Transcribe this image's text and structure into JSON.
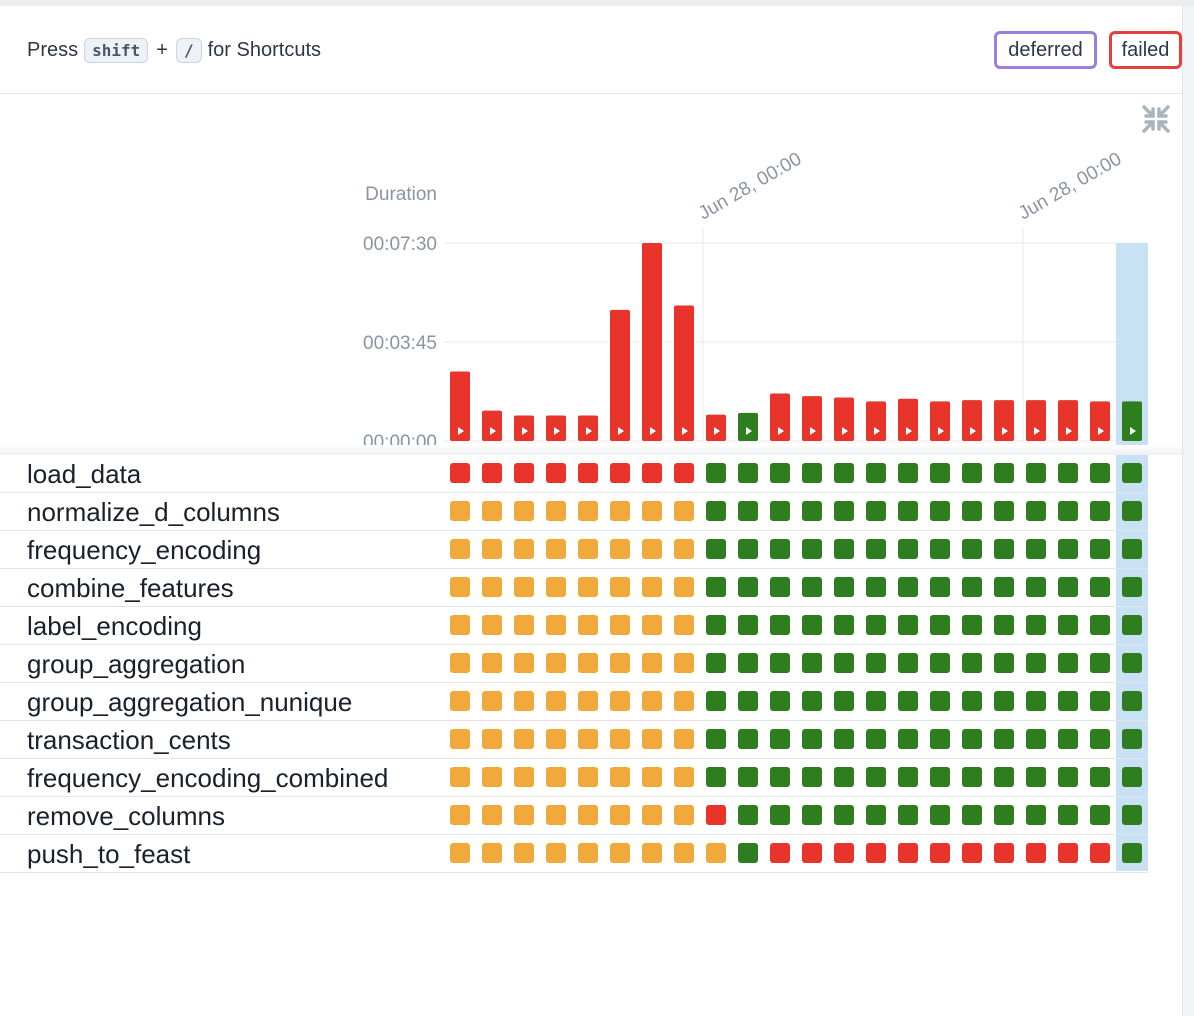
{
  "header": {
    "press_label": "Press",
    "key_shift": "shift",
    "plus": "+",
    "key_slash": "/",
    "shortcuts_label": "for Shortcuts",
    "badge_deferred": "deferred",
    "badge_failed": "failed"
  },
  "colors": {
    "success": "#2e7d1f",
    "failed": "#e8342a",
    "upstream_failed": "#f2a93b",
    "selected_column": "#c8e1f5",
    "deferred_border": "#9b7fe0",
    "failed_border": "#e53e3e"
  },
  "icons": {
    "collapse": "collapse-arrows-icon",
    "play": "play-triangle-icon"
  },
  "chart_data": {
    "type": "bar",
    "title": "",
    "ylabel": "Duration",
    "xlabel": "",
    "yticks": [
      "00:00:00",
      "00:03:45",
      "00:07:30"
    ],
    "ylim_seconds": [
      0,
      450
    ],
    "x_annotations": [
      {
        "label": "Jun 28, 00:00",
        "run_index": 8
      },
      {
        "label": "Jun 28, 00:00",
        "run_index": 18
      }
    ],
    "durations_seconds": [
      158,
      69,
      58,
      58,
      58,
      298,
      450,
      308,
      60,
      64,
      108,
      102,
      99,
      90,
      96,
      90,
      93,
      93,
      93,
      93,
      90,
      90
    ],
    "run_states": [
      "failed",
      "failed",
      "failed",
      "failed",
      "failed",
      "failed",
      "failed",
      "failed",
      "failed",
      "success",
      "failed",
      "failed",
      "failed",
      "failed",
      "failed",
      "failed",
      "failed",
      "failed",
      "failed",
      "failed",
      "failed",
      "success"
    ],
    "selected_run_index": 21
  },
  "tasks": [
    {
      "name": "load_data",
      "states": [
        "failed",
        "failed",
        "failed",
        "failed",
        "failed",
        "failed",
        "failed",
        "failed",
        "success",
        "success",
        "success",
        "success",
        "success",
        "success",
        "success",
        "success",
        "success",
        "success",
        "success",
        "success",
        "success",
        "success"
      ]
    },
    {
      "name": "normalize_d_columns",
      "states": [
        "upstream_failed",
        "upstream_failed",
        "upstream_failed",
        "upstream_failed",
        "upstream_failed",
        "upstream_failed",
        "upstream_failed",
        "upstream_failed",
        "success",
        "success",
        "success",
        "success",
        "success",
        "success",
        "success",
        "success",
        "success",
        "success",
        "success",
        "success",
        "success",
        "success"
      ]
    },
    {
      "name": "frequency_encoding",
      "states": [
        "upstream_failed",
        "upstream_failed",
        "upstream_failed",
        "upstream_failed",
        "upstream_failed",
        "upstream_failed",
        "upstream_failed",
        "upstream_failed",
        "success",
        "success",
        "success",
        "success",
        "success",
        "success",
        "success",
        "success",
        "success",
        "success",
        "success",
        "success",
        "success",
        "success"
      ]
    },
    {
      "name": "combine_features",
      "states": [
        "upstream_failed",
        "upstream_failed",
        "upstream_failed",
        "upstream_failed",
        "upstream_failed",
        "upstream_failed",
        "upstream_failed",
        "upstream_failed",
        "success",
        "success",
        "success",
        "success",
        "success",
        "success",
        "success",
        "success",
        "success",
        "success",
        "success",
        "success",
        "success",
        "success"
      ]
    },
    {
      "name": "label_encoding",
      "states": [
        "upstream_failed",
        "upstream_failed",
        "upstream_failed",
        "upstream_failed",
        "upstream_failed",
        "upstream_failed",
        "upstream_failed",
        "upstream_failed",
        "success",
        "success",
        "success",
        "success",
        "success",
        "success",
        "success",
        "success",
        "success",
        "success",
        "success",
        "success",
        "success",
        "success"
      ]
    },
    {
      "name": "group_aggregation",
      "states": [
        "upstream_failed",
        "upstream_failed",
        "upstream_failed",
        "upstream_failed",
        "upstream_failed",
        "upstream_failed",
        "upstream_failed",
        "upstream_failed",
        "success",
        "success",
        "success",
        "success",
        "success",
        "success",
        "success",
        "success",
        "success",
        "success",
        "success",
        "success",
        "success",
        "success"
      ]
    },
    {
      "name": "group_aggregation_nunique",
      "states": [
        "upstream_failed",
        "upstream_failed",
        "upstream_failed",
        "upstream_failed",
        "upstream_failed",
        "upstream_failed",
        "upstream_failed",
        "upstream_failed",
        "success",
        "success",
        "success",
        "success",
        "success",
        "success",
        "success",
        "success",
        "success",
        "success",
        "success",
        "success",
        "success",
        "success"
      ]
    },
    {
      "name": "transaction_cents",
      "states": [
        "upstream_failed",
        "upstream_failed",
        "upstream_failed",
        "upstream_failed",
        "upstream_failed",
        "upstream_failed",
        "upstream_failed",
        "upstream_failed",
        "success",
        "success",
        "success",
        "success",
        "success",
        "success",
        "success",
        "success",
        "success",
        "success",
        "success",
        "success",
        "success",
        "success"
      ]
    },
    {
      "name": "frequency_encoding_combined",
      "states": [
        "upstream_failed",
        "upstream_failed",
        "upstream_failed",
        "upstream_failed",
        "upstream_failed",
        "upstream_failed",
        "upstream_failed",
        "upstream_failed",
        "success",
        "success",
        "success",
        "success",
        "success",
        "success",
        "success",
        "success",
        "success",
        "success",
        "success",
        "success",
        "success",
        "success"
      ]
    },
    {
      "name": "remove_columns",
      "states": [
        "upstream_failed",
        "upstream_failed",
        "upstream_failed",
        "upstream_failed",
        "upstream_failed",
        "upstream_failed",
        "upstream_failed",
        "upstream_failed",
        "failed",
        "success",
        "success",
        "success",
        "success",
        "success",
        "success",
        "success",
        "success",
        "success",
        "success",
        "success",
        "success",
        "success"
      ]
    },
    {
      "name": "push_to_feast",
      "states": [
        "upstream_failed",
        "upstream_failed",
        "upstream_failed",
        "upstream_failed",
        "upstream_failed",
        "upstream_failed",
        "upstream_failed",
        "upstream_failed",
        "upstream_failed",
        "success",
        "failed",
        "failed",
        "failed",
        "failed",
        "failed",
        "failed",
        "failed",
        "failed",
        "failed",
        "failed",
        "failed",
        "success"
      ]
    }
  ]
}
